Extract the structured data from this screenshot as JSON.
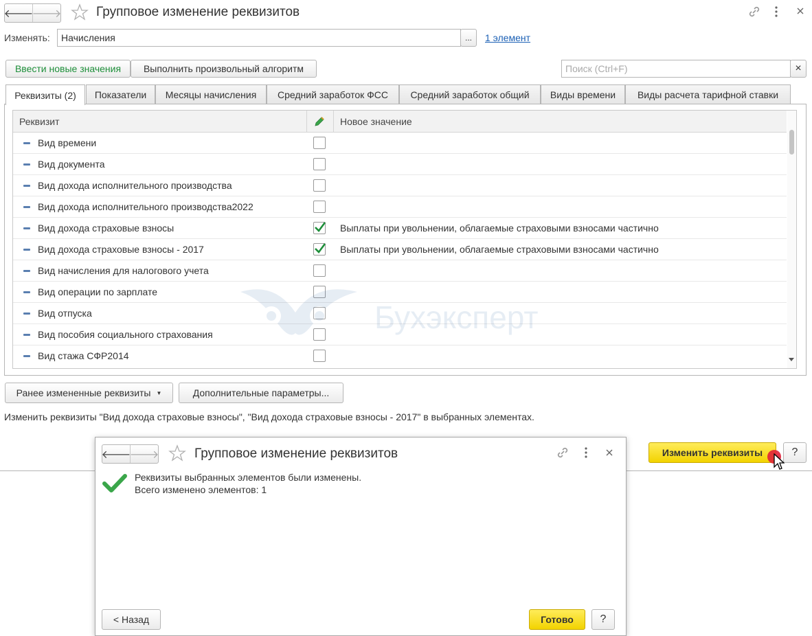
{
  "window": {
    "title": "Групповое изменение реквизитов"
  },
  "change_field": {
    "label": "Изменять:",
    "value": "Начисления",
    "ellipsis": "...",
    "link": "1 элемент"
  },
  "toolbar": {
    "enter_values": "Ввести новые значения",
    "run_algorithm": "Выполнить произвольный алгоритм",
    "search_placeholder": "Поиск (Ctrl+F)",
    "search_clear": "×"
  },
  "tabs": [
    "Реквизиты (2)",
    "Показатели",
    "Месяцы начисления",
    "Средний заработок ФСС",
    "Средний заработок общий",
    "Виды времени",
    "Виды расчета тарифной ставки"
  ],
  "table": {
    "col_attribute": "Реквизит",
    "col_new_value": "Новое значение",
    "rows": [
      {
        "name": "Вид времени",
        "checked": false,
        "value": ""
      },
      {
        "name": "Вид документа",
        "checked": false,
        "value": ""
      },
      {
        "name": "Вид дохода исполнительного производства",
        "checked": false,
        "value": ""
      },
      {
        "name": "Вид дохода исполнительного производства2022",
        "checked": false,
        "value": ""
      },
      {
        "name": "Вид дохода страховые взносы",
        "checked": true,
        "value": "Выплаты при увольнении, облагаемые страховыми взносами частично"
      },
      {
        "name": "Вид дохода страховые взносы - 2017",
        "checked": true,
        "value": "Выплаты при увольнении, облагаемые страховыми взносами частично"
      },
      {
        "name": "Вид начисления для налогового учета",
        "checked": false,
        "value": ""
      },
      {
        "name": "Вид операции по зарплате",
        "checked": false,
        "value": ""
      },
      {
        "name": "Вид отпуска",
        "checked": false,
        "value": ""
      },
      {
        "name": "Вид пособия социального страхования",
        "checked": false,
        "value": ""
      },
      {
        "name": "Вид стажа  СФР2014",
        "checked": false,
        "value": ""
      }
    ]
  },
  "watermark": "Бухэксперт",
  "bottom": {
    "prev_changed": "Ранее измененные реквизиты",
    "extra_params": "Дополнительные параметры...",
    "info": "Изменить реквизиты \"Вид дохода страховые взносы\", \"Вид дохода страховые взносы - 2017\" в выбранных элементах.",
    "change_button": "Изменить реквизиты",
    "help": "?"
  },
  "dialog": {
    "title": "Групповое изменение реквизитов",
    "message_line1": "Реквизиты выбранных элементов были изменены.",
    "message_line2": "Всего изменено элементов: 1",
    "back": "< Назад",
    "done": "Готово",
    "help": "?"
  },
  "colors": {
    "accent_green": "#1e8f3a",
    "link_blue": "#1a5fb4",
    "button_yellow": "#f5d800",
    "cursor_red": "#e0213a"
  }
}
